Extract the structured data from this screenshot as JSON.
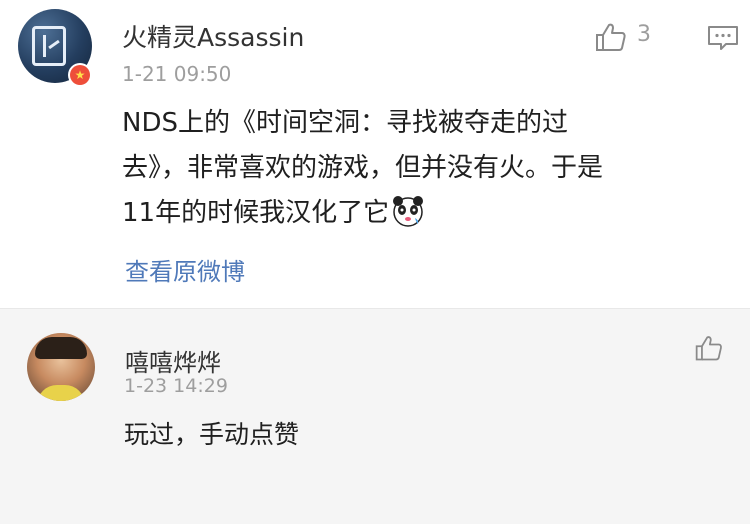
{
  "main_comment": {
    "user_name": "火精灵Assassin",
    "timestamp": "1-21 09:50",
    "like_count": "3",
    "content_lines": [
      "NDS上的《时间空洞：寻找被夺走的过",
      "去》，非常喜欢的游戏，但并没有火。于是",
      "11年的时候我汉化了它"
    ],
    "view_original_label": "查看原微博",
    "badge_icon": "vip-badge-icon",
    "emoji_icon": "panda-emoji-icon"
  },
  "reply_comment": {
    "user_name": "嘻嘻烨烨",
    "timestamp": "1-23 14:29",
    "content": "玩过，手动点赞"
  },
  "colors": {
    "link": "#4f79b9",
    "meta_text": "#9e9e9e",
    "reply_background": "#f5f5f5",
    "badge": "#ee4e3a"
  }
}
